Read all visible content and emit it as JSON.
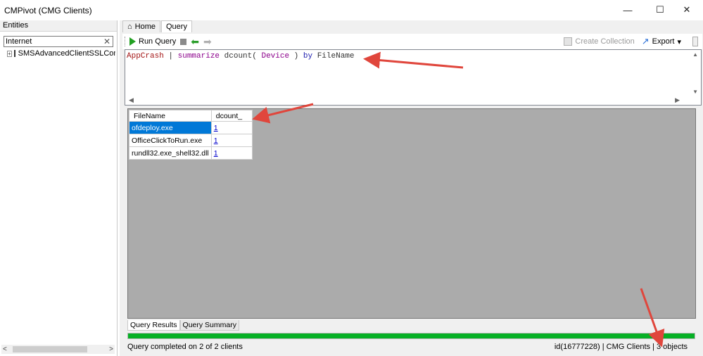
{
  "window": {
    "title": "CMPivot (CMG Clients)",
    "minimize_glyph": "—",
    "maximize_glyph": "☐",
    "close_glyph": "✕"
  },
  "entities": {
    "header": "Entities",
    "search_value": "Internet",
    "clear_glyph": "✕",
    "tree_items": [
      {
        "label": "SMSAdvancedClientSSLConfig",
        "expander": "+"
      }
    ],
    "scroll_left": "<",
    "scroll_right": ">"
  },
  "tabs": [
    {
      "label": "Home",
      "icon": "home-icon",
      "active": false
    },
    {
      "label": "Query",
      "active": true
    }
  ],
  "toolbar": {
    "run_query": "Run Query",
    "create_collection": "Create Collection",
    "export": "Export"
  },
  "editor": {
    "query_parts": {
      "table": "AppCrash",
      "pipe": " | ",
      "op": "summarize",
      "fn": " dcount( ",
      "column": "Device",
      "close": " ) ",
      "by": "by",
      "group": " FileName"
    }
  },
  "results": {
    "columns": [
      "FileName",
      "dcount_"
    ],
    "rows": [
      {
        "file": "ofdeploy.exe",
        "count": "1",
        "selected": true
      },
      {
        "file": "OfficeClickToRun.exe",
        "count": "1",
        "selected": false
      },
      {
        "file": "rundll32.exe_shell32.dll",
        "count": "1",
        "selected": false
      }
    ],
    "tabs": [
      "Query Results",
      "Query Summary"
    ],
    "progress_fraction": 1.0
  },
  "status": {
    "left": "Query completed on 2 of 2 clients",
    "right": "id(16777228)  |  CMG Clients  |  3 objects"
  },
  "colors": {
    "annotation_arrow": "#e0463c",
    "progress": "#06b025",
    "selection": "#0078d7"
  }
}
